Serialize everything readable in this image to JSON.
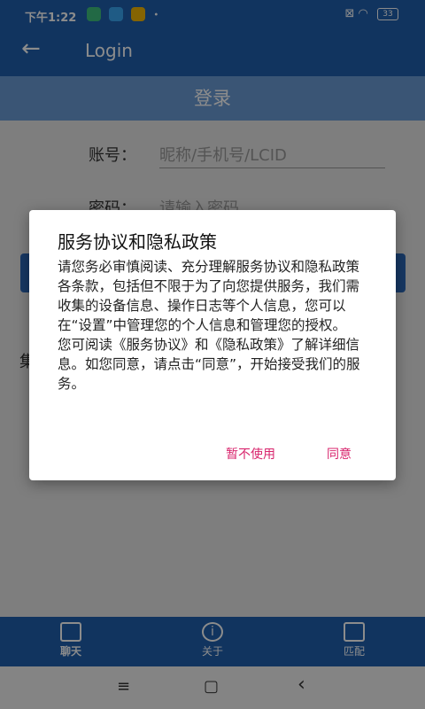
{
  "status": {
    "time": "下午1:22",
    "battery": "33"
  },
  "appbar": {
    "back_glyph": "←",
    "title": "Login"
  },
  "banner": {
    "title": "登录"
  },
  "form": {
    "account_label": "账号：",
    "account_placeholder": "昵称/手机号/LCID",
    "password_label": "密码：",
    "password_placeholder": "请输入密码",
    "side_char": "集"
  },
  "dialog": {
    "title": "服务协议和隐私政策",
    "body": "请您务必审慎阅读、充分理解服务协议和隐私政策各条款，包括但不限于为了向您提供服务，我们需收集的设备信息、操作日志等个人信息，您可以在“设置”中管理您的个人信息和管理您的授权。\n您可阅读《服务协议》和《隐私政策》了解详细信息。如您同意，请点击“同意”，开始接受我们的服务。",
    "decline": "暂不使用",
    "agree": "同意"
  },
  "nav": {
    "chat": "聊天",
    "about": "关于",
    "match": "匹配"
  },
  "sysnav": {
    "menu": "≡",
    "home": "▢",
    "back": "‹"
  },
  "colors": {
    "primary": "#1f5fae",
    "accent": "#d8246c"
  }
}
